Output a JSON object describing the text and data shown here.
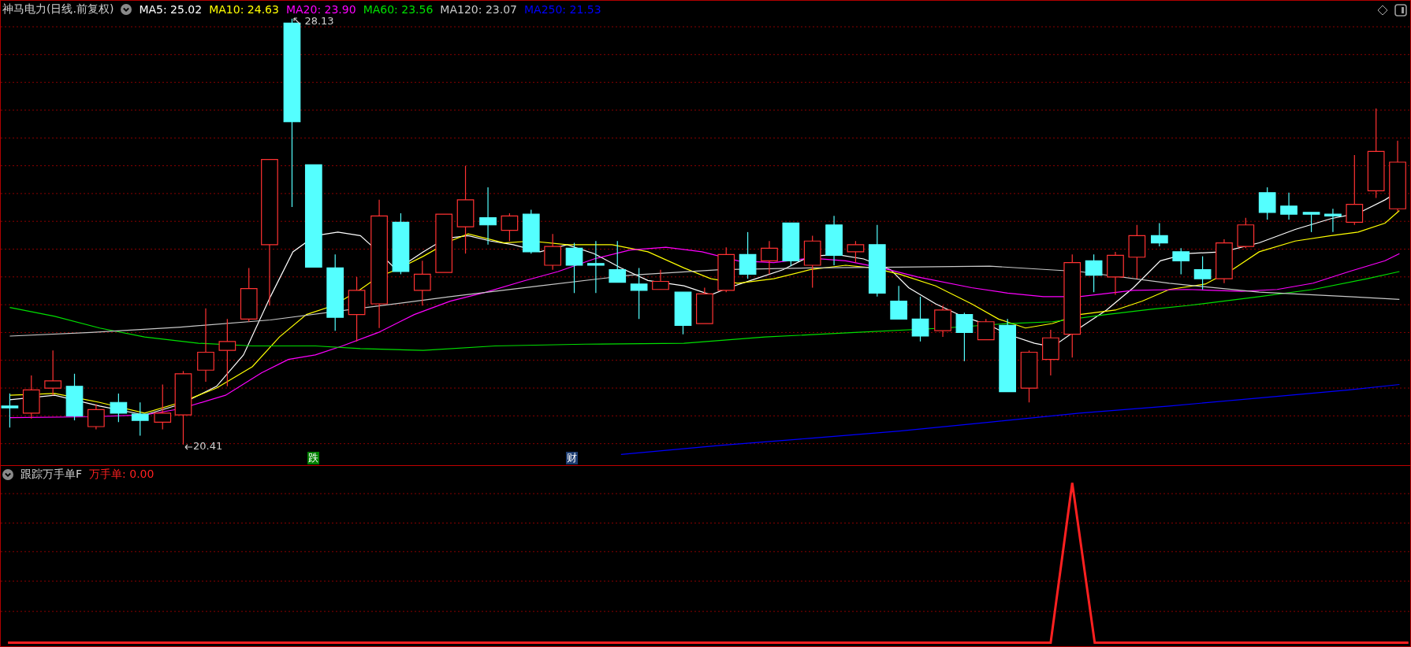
{
  "main_panel": {
    "title": "神马电力(日线.前复权)",
    "indicators": [
      {
        "label": "MA5: 25.02",
        "color": "#ffffff"
      },
      {
        "label": "MA10: 24.63",
        "color": "#ffff00"
      },
      {
        "label": "MA20: 23.90",
        "color": "#ff00ff"
      },
      {
        "label": "MA60: 23.56",
        "color": "#00e000"
      },
      {
        "label": "MA120: 23.07",
        "color": "#c8c8c8"
      },
      {
        "label": "MA250: 21.53",
        "color": "#0000ff"
      }
    ],
    "high_label": "28.13",
    "low_label": "20.41",
    "signals": [
      {
        "label": "跌",
        "color": "#008000"
      },
      {
        "label": "财",
        "color": "#1c3c70"
      }
    ]
  },
  "sub_panel": {
    "title": "跟踪万手单F",
    "indicators": [
      {
        "label": "万手单: 0.00",
        "color": "#ff2020"
      }
    ]
  }
}
